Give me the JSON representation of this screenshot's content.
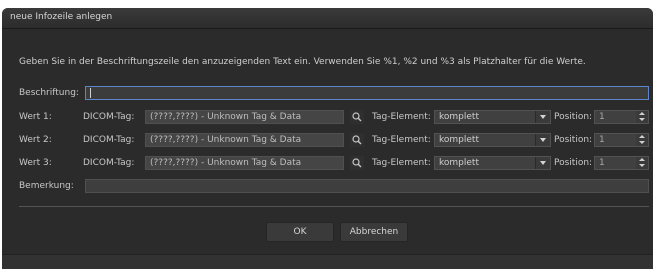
{
  "window": {
    "title": "neue Infozeile anlegen"
  },
  "instruction": "Geben Sie in der Beschriftungszeile den anzuzeigenden Text ein. Verwenden Sie %1, %2 und %3 als Platzhalter für die Werte.",
  "caption": {
    "label": "Beschriftung:",
    "value": ""
  },
  "dicom_label": "DICOM-Tag:",
  "tag_element_label": "Tag-Element:",
  "position_label": "Position:",
  "values": [
    {
      "label": "Wert 1:",
      "tag": "(????,????) - Unknown Tag & Data",
      "element": "komplett",
      "position": "1"
    },
    {
      "label": "Wert 2:",
      "tag": "(????,????) - Unknown Tag & Data",
      "element": "komplett",
      "position": "1"
    },
    {
      "label": "Wert 3:",
      "tag": "(????,????) - Unknown Tag & Data",
      "element": "komplett",
      "position": "1"
    }
  ],
  "remark": {
    "label": "Bemerkung:",
    "value": ""
  },
  "buttons": {
    "ok": "OK",
    "cancel": "Abbrechen"
  },
  "icons": {
    "tag_picker": "search-icon",
    "dropdown": "chevron-down-icon",
    "spinner": "spinner-arrows-icon"
  },
  "colors": {
    "background": "#2b2b2b",
    "focus_border": "#5b86c9",
    "field_bg": "#3e3e3e"
  }
}
